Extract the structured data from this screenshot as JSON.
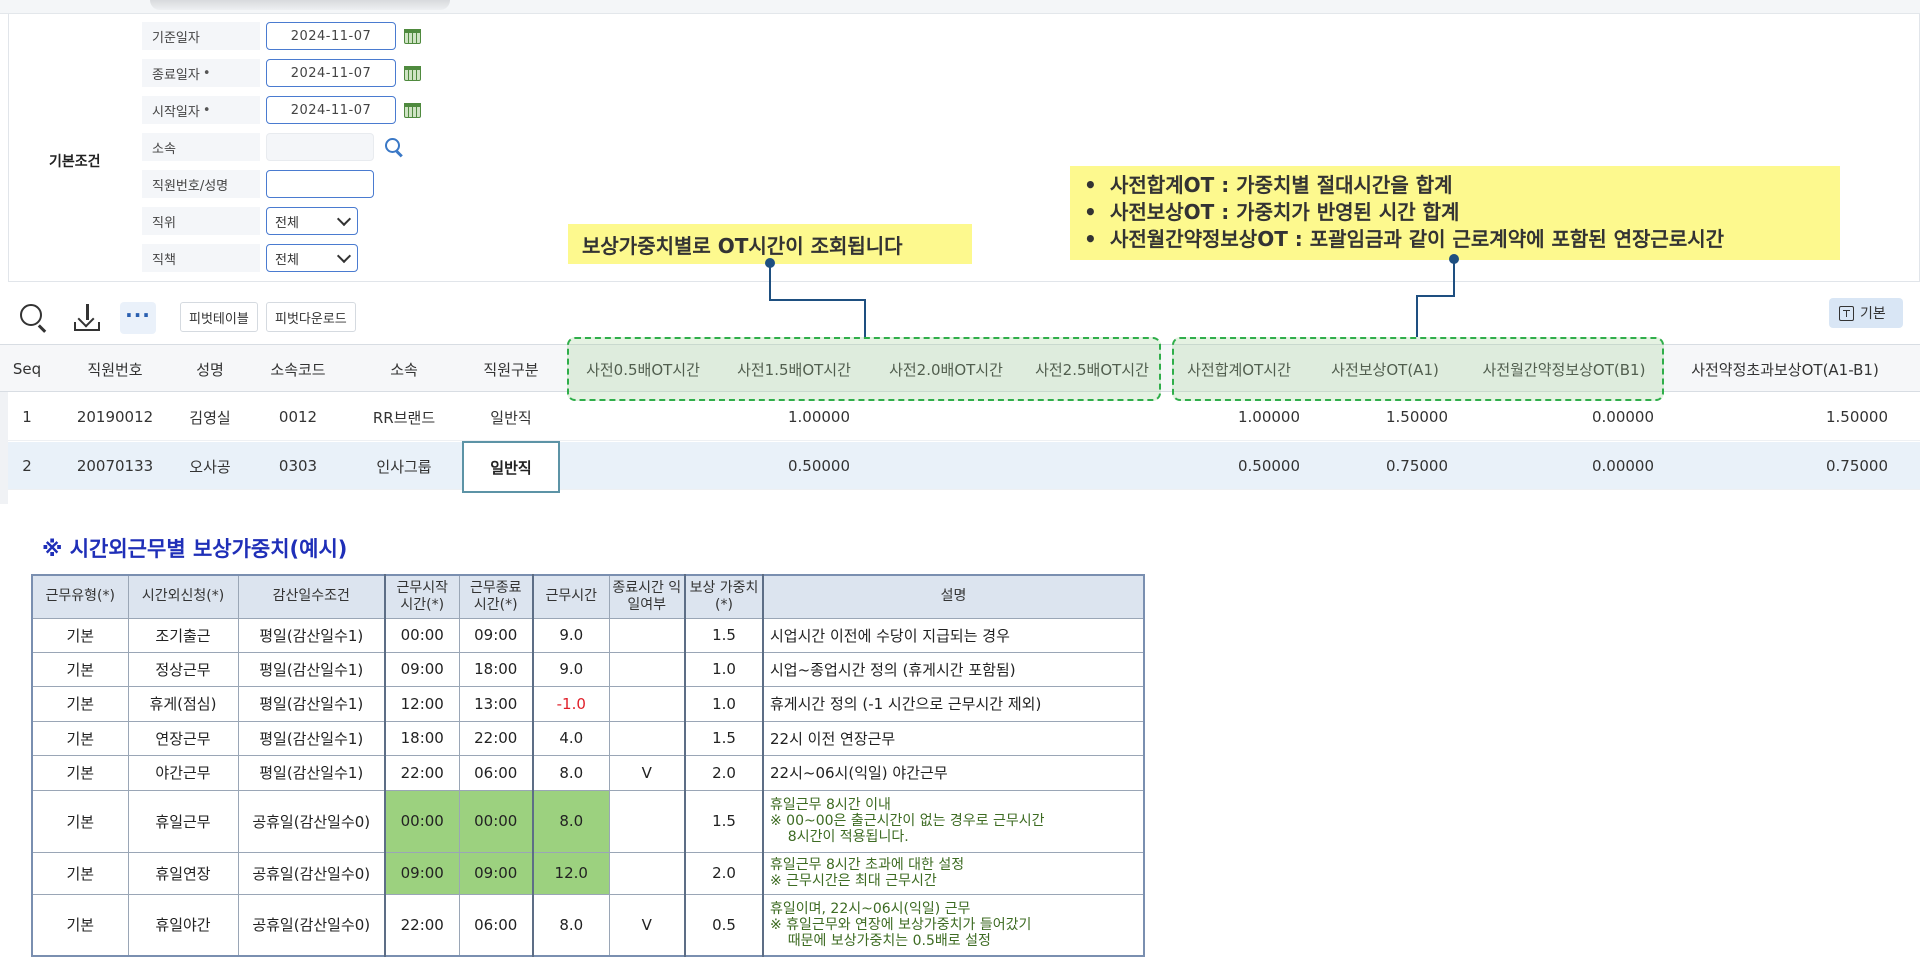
{
  "conditions": {
    "title": "기본조건",
    "fields": [
      {
        "label": "기준일자",
        "required": false,
        "value": "2024-11-07",
        "type": "date"
      },
      {
        "label": "종료일자",
        "required": true,
        "value": "2024-11-07",
        "type": "date"
      },
      {
        "label": "시작일자",
        "required": true,
        "value": "2024-11-07",
        "type": "date"
      },
      {
        "label": "소속",
        "required": false,
        "value": "",
        "type": "search"
      },
      {
        "label": "직원번호/성명",
        "required": false,
        "value": "",
        "type": "text"
      },
      {
        "label": "직위",
        "required": false,
        "value": "전체",
        "type": "select"
      },
      {
        "label": "직책",
        "required": false,
        "value": "전체",
        "type": "select"
      }
    ],
    "required_mark": "•"
  },
  "callouts": {
    "weight": "보상가중치별로 OT시간이 조회됩니다",
    "bullets": [
      "사전합계OT : 가중치별 절대시간을 합계",
      "사전보상OT : 가중치가 반영된 시간 합계",
      "사전월간약정보상OT : 포괄임금과 같이 근로계약에 포함된 연장근로시간"
    ],
    "highlight_color": "#fdf98e",
    "dash_color": "#2fae4a"
  },
  "toolbar": {
    "more": "···",
    "pivot_table": "피벗테이블",
    "pivot_download": "피벗다운로드",
    "basic": "기본"
  },
  "grid": {
    "headers": {
      "seq": "Seq",
      "emp_no": "직원번호",
      "name": "성명",
      "org_code": "소속코드",
      "org": "소속",
      "emp_type": "직원구분",
      "ot05": "사전0.5배OT시간",
      "ot15": "사전1.5배OT시간",
      "ot20": "사전2.0배OT시간",
      "ot25": "사전2.5배OT시간",
      "total": "사전합계OT시간",
      "comp": "사전보상OT(A1)",
      "monthly": "사전월간약정보상OT(B1)",
      "excess": "사전약정초과보상OT(A1-B1)"
    },
    "rows": [
      {
        "seq": "1",
        "emp_no": "20190012",
        "name": "김영실",
        "org_code": "0012",
        "org": "RR브랜드",
        "emp_type": "일반직",
        "ot15": "1.00000",
        "total": "1.00000",
        "comp": "1.50000",
        "monthly": "0.00000",
        "excess": "1.50000"
      },
      {
        "seq": "2",
        "emp_no": "20070133",
        "name": "오사공",
        "org_code": "0303",
        "org": "인사그룹",
        "emp_type": "일반직",
        "ot15": "0.50000",
        "total": "0.50000",
        "comp": "0.75000",
        "monthly": "0.00000",
        "excess": "0.75000"
      }
    ]
  },
  "example": {
    "title": "※ 시간외근무별 보상가중치(예시)",
    "headers": [
      "근무유형(*)",
      "시간외신청(*)",
      "감산일수조건",
      "근무시작 시간(*)",
      "근무종료 시간(*)",
      "근무시간",
      "종료시간 익일여부",
      "보상 가중치(*)",
      "설명"
    ],
    "rows": [
      {
        "type": "기본",
        "ot": "조기출근",
        "cond": "평일(감산일수1)",
        "start": "00:00",
        "end": "09:00",
        "hours": "9.0",
        "next": "",
        "weight": "1.5",
        "desc": [
          "시업시간 이전에 수당이 지급되는 경우"
        ]
      },
      {
        "type": "기본",
        "ot": "정상근무",
        "cond": "평일(감산일수1)",
        "start": "09:00",
        "end": "18:00",
        "hours": "9.0",
        "next": "",
        "weight": "1.0",
        "desc": [
          "시업~종업시간 정의 (휴게시간 포함됨)"
        ]
      },
      {
        "type": "기본",
        "ot": "휴게(점심)",
        "cond": "평일(감산일수1)",
        "start": "12:00",
        "end": "13:00",
        "hours": "-1.0",
        "next": "",
        "weight": "1.0",
        "desc": [
          "휴게시간 정의 (-1 시간으로 근무시간 제외)"
        ]
      },
      {
        "type": "기본",
        "ot": "연장근무",
        "cond": "평일(감산일수1)",
        "start": "18:00",
        "end": "22:00",
        "hours": "4.0",
        "next": "",
        "weight": "1.5",
        "desc": [
          "22시 이전 연장근무"
        ]
      },
      {
        "type": "기본",
        "ot": "야간근무",
        "cond": "평일(감산일수1)",
        "start": "22:00",
        "end": "06:00",
        "hours": "8.0",
        "next": "V",
        "weight": "2.0",
        "desc": [
          "22시~06시(익일) 야간근무"
        ]
      },
      {
        "type": "기본",
        "ot": "휴일근무",
        "cond": "공휴일(감산일수0)",
        "start": "00:00",
        "end": "00:00",
        "hours": "8.0",
        "next": "",
        "weight": "1.5",
        "desc": [
          "휴일근무 8시간 이내",
          "※ 00~00은 출근시간이 없는 경우로 근무시간",
          "    8시간이 적용됩니다."
        ]
      },
      {
        "type": "기본",
        "ot": "휴일연장",
        "cond": "공휴일(감산일수0)",
        "start": "09:00",
        "end": "09:00",
        "hours": "12.0",
        "next": "",
        "weight": "2.0",
        "desc": [
          "휴일근무 8시간 초과에 대한 설정",
          "※ 근무시간은 최대 근무시간"
        ]
      },
      {
        "type": "기본",
        "ot": "휴일야간",
        "cond": "공휴일(감산일수0)",
        "start": "22:00",
        "end": "06:00",
        "hours": "8.0",
        "next": "V",
        "weight": "0.5",
        "desc": [
          "휴일이며, 22시~06시(익일) 근무",
          "※ 휴일근무와 연장에 보상가중치가 들어갔기",
          "    때문에 보상가중치는 0.5배로 설정"
        ]
      }
    ],
    "green_fill": "#9cd17f",
    "negative_color": "#e0202a"
  }
}
